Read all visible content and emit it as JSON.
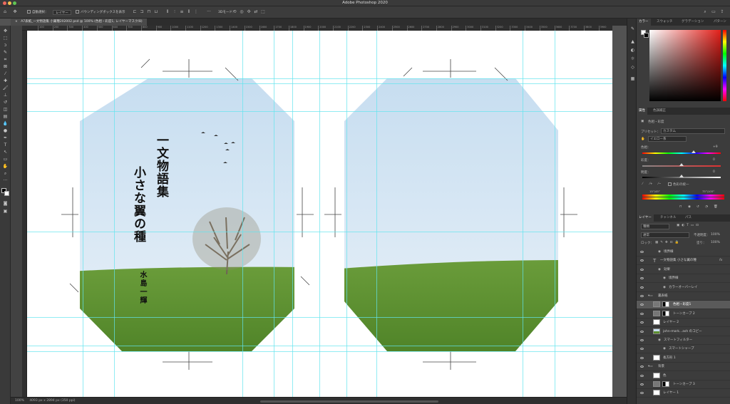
{
  "window": {
    "title": "Adobe Photoshop 2020"
  },
  "options_bar": {
    "auto_select": "自動選択：",
    "target": "レイヤー",
    "show_transform": "バウンディングボックスを表示",
    "mode_3d": "3Dモード："
  },
  "document_tab": {
    "label": "A7表紙_一文物語集 小翼種202002.psd @ 100% (色相・彩度1, レイヤーマスク/8)",
    "close": "×"
  },
  "ruler": {
    "ticks": [
      "100",
      "200",
      "300",
      "400",
      "500",
      "600",
      "700",
      "800",
      "900",
      "1000",
      "1100",
      "1200",
      "1300",
      "1400",
      "1500",
      "1600",
      "1700",
      "1800",
      "1900",
      "2000",
      "2100",
      "2200",
      "2300",
      "2400",
      "2500",
      "2600",
      "2700",
      "2800",
      "2900",
      "3000",
      "3100",
      "3200",
      "3300",
      "3400",
      "3500",
      "3600",
      "3700",
      "3800",
      "3900",
      "4000"
    ]
  },
  "status": {
    "zoom": "100%",
    "doc_size": "4093 px x 2894 px (350 ppi)"
  },
  "cover": {
    "title_line1": "一文物語集",
    "title_line2": "小さな翼の種",
    "author": "水島一輝"
  },
  "color_panel": {
    "tabs": [
      "カラー",
      "スウォッチ",
      "グラデーション",
      "パターン"
    ]
  },
  "properties_panel": {
    "tabs": [
      "属性",
      "色調補正"
    ],
    "type": "色相・彩度",
    "preset_label": "プリセット：",
    "preset_value": "カスタム",
    "channel": "イエロー系",
    "hue_label": "色相：",
    "hue_value": "+9",
    "hue_fraction": 0.65,
    "sat_label": "彩度：",
    "sat_value": "0",
    "sat_fraction": 0.5,
    "light_label": "明度：",
    "light_value": "0",
    "light_fraction": 0.5,
    "colorize": "色彩の統一",
    "range_left": "15°/45°",
    "range_right": "75°\\105°"
  },
  "layers_panel": {
    "tabs": [
      "レイヤー",
      "チャンネル",
      "パス"
    ],
    "kind": "種類",
    "blend": "通常",
    "opacity_label": "不透明度：",
    "opacity": "100%",
    "lock_label": "ロック：",
    "fill_label": "塗り：",
    "fill": "100%",
    "items": [
      {
        "name": "境界線",
        "kind": "effect",
        "indent": 2
      },
      {
        "name": "一文物語集 小さな翼の種",
        "kind": "text",
        "indent": 1,
        "fx": "fx"
      },
      {
        "name": "効果",
        "kind": "effect",
        "indent": 2
      },
      {
        "name": "境界線",
        "kind": "effect",
        "indent": 3
      },
      {
        "name": "カラーオーバーレイ",
        "kind": "effect",
        "indent": 3
      },
      {
        "name": "裏表紙",
        "kind": "group",
        "indent": 0
      },
      {
        "name": "色相・彩度1",
        "kind": "adj",
        "indent": 1,
        "selected": true
      },
      {
        "name": "トーンカーブ 2",
        "kind": "adj",
        "indent": 1
      },
      {
        "name": "レイヤー 2",
        "kind": "layer",
        "indent": 1
      },
      {
        "name": "john-mark...ash のコピー",
        "kind": "photo",
        "indent": 1
      },
      {
        "name": "スマートフィルター",
        "kind": "effect",
        "indent": 2
      },
      {
        "name": "スマートシャープ",
        "kind": "effect",
        "indent": 3
      },
      {
        "name": "長方形 1",
        "kind": "shape",
        "indent": 1
      },
      {
        "name": "背景",
        "kind": "group",
        "indent": 0
      },
      {
        "name": "色",
        "kind": "layer",
        "indent": 1
      },
      {
        "name": "トーンカーブ 3",
        "kind": "adj",
        "indent": 1
      },
      {
        "name": "レイヤー 1",
        "kind": "layer",
        "indent": 1
      }
    ]
  },
  "colors": {
    "accent": "#2d75c8",
    "guide": "#62e4ee",
    "sky_top": "#c6ddf0",
    "grass": "#5d8f2e"
  }
}
